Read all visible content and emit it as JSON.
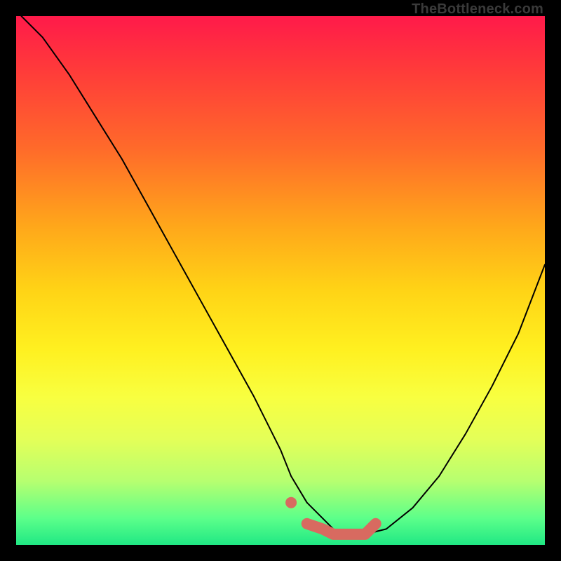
{
  "credit": "TheBottleneck.com",
  "colors": {
    "curve": "#000000",
    "highlight": "#d86a60",
    "gradient_top": "#ff1a4a",
    "gradient_bottom": "#20e884"
  },
  "chart_data": {
    "type": "line",
    "title": "",
    "xlabel": "",
    "ylabel": "",
    "xlim": [
      0,
      100
    ],
    "ylim": [
      0,
      100
    ],
    "grid": false,
    "series": [
      {
        "name": "bottleneck-curve",
        "color": "#000000",
        "x": [
          1,
          5,
          10,
          15,
          20,
          25,
          30,
          35,
          40,
          45,
          50,
          52,
          55,
          58,
          60,
          62,
          64,
          66,
          70,
          75,
          80,
          85,
          90,
          95,
          100
        ],
        "y": [
          100,
          96,
          89,
          81,
          73,
          64,
          55,
          46,
          37,
          28,
          18,
          13,
          8,
          5,
          3,
          2,
          2,
          2,
          3,
          7,
          13,
          21,
          30,
          40,
          53
        ]
      }
    ],
    "highlight_segment": {
      "color": "#d86a60",
      "note": "thick salmon overlay on the valley floor",
      "x": [
        52,
        55,
        58,
        60,
        62,
        64,
        66,
        68
      ],
      "y": [
        8,
        4,
        3,
        2,
        2,
        2,
        2,
        4
      ]
    }
  }
}
